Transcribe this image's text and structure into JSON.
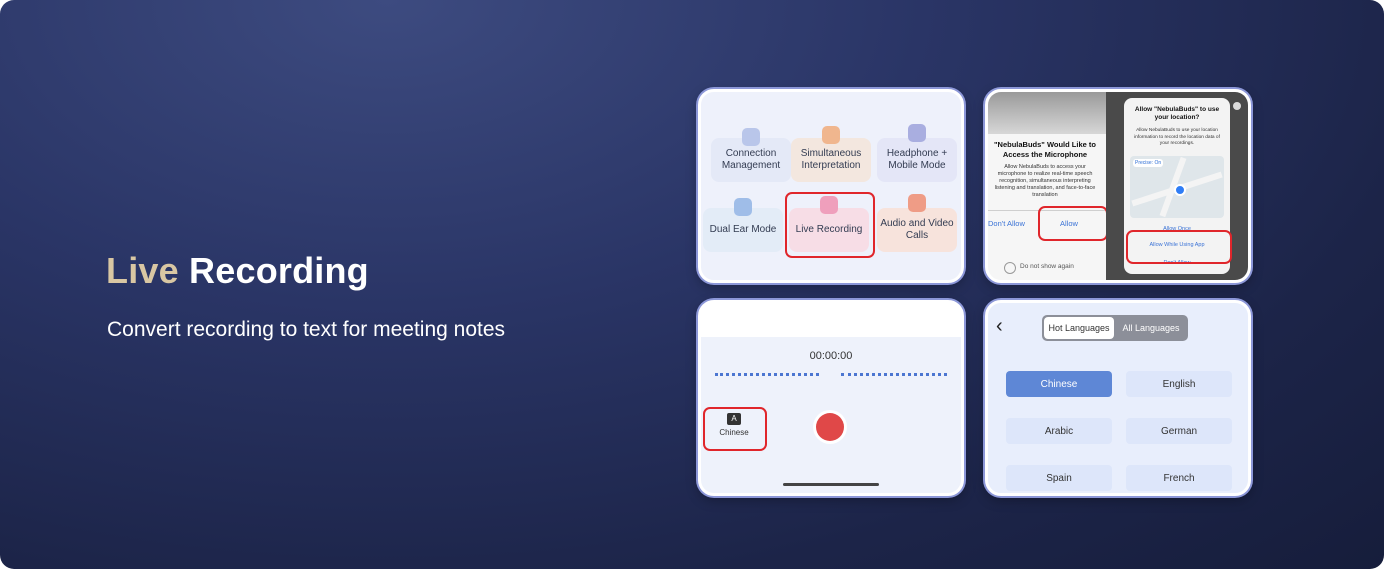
{
  "headline": {
    "word1": "Live",
    "word2": "Recording"
  },
  "subtitle": "Convert recording to text for meeting notes",
  "panel1": {
    "features": [
      {
        "label": "Connection Management",
        "icon": "bluetooth-icon"
      },
      {
        "label": "Simultaneous Interpretation",
        "icon": "translate-icon"
      },
      {
        "label": "Headphone + Mobile Mode",
        "icon": "phone-icon"
      },
      {
        "label": "Dual Ear Mode",
        "icon": "earbuds-icon"
      },
      {
        "label": "Live Recording",
        "icon": "microphone-icon"
      },
      {
        "label": "Audio and Video Calls",
        "icon": "video-call-icon"
      }
    ]
  },
  "panel2": {
    "mic_title": "\"NebulaBuds\" Would Like to Access the Microphone",
    "mic_body": "Allow NebulaBuds to access your microphone to realize real-time speech recognition, simultaneous interpreting listening and translation, and face-to-face translation",
    "dont_allow": "Don't Allow",
    "allow": "Allow",
    "do_not_show": "Do not show again",
    "loc_title": "Allow \"NebulaBuds\" to use your location?",
    "loc_body": "Allow NebulaBuds to use your location information to record the location data of your recordings.",
    "precise": "Precise: On",
    "allow_once": "Allow Once",
    "allow_while_using": "Allow While Using App",
    "dont_allow2": "Don't Allow"
  },
  "panel3": {
    "timer": "00:00:00",
    "language": "Chinese",
    "lang_icon_letter": "A"
  },
  "panel4": {
    "tab_hot": "Hot Languages",
    "tab_all": "All Languages",
    "languages": [
      "Chinese",
      "English",
      "Arabic",
      "German",
      "Spain",
      "French"
    ]
  },
  "colors": {
    "accent_gold": "#d9c7a3",
    "highlight_red": "#e0262b",
    "selected_blue": "#5e87d6",
    "record_red": "#e04848"
  }
}
